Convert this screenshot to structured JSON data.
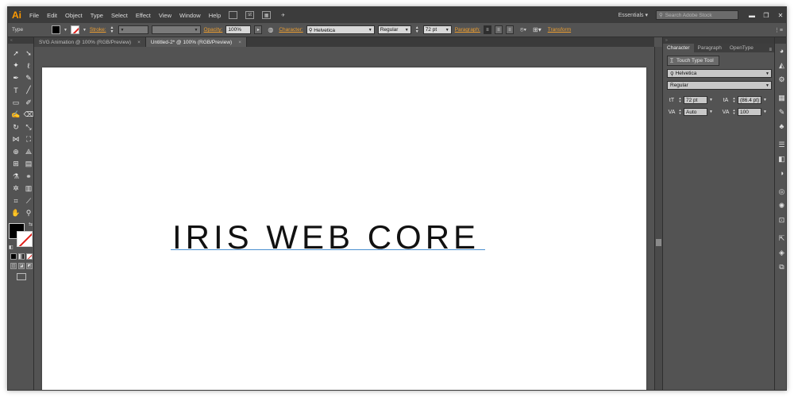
{
  "app": {
    "logo": "Ai",
    "workspace": "Essentials ▾",
    "stock_search_placeholder": "Search Adobe Stock"
  },
  "menu": [
    "File",
    "Edit",
    "Object",
    "Type",
    "Select",
    "Effect",
    "View",
    "Window",
    "Help"
  ],
  "menu_icons": [
    "st",
    "bridge-icon",
    "arrange-icon",
    "gpu-icon"
  ],
  "control_bar": {
    "tool_label": "Type",
    "stroke_label": "Stroke:",
    "opacity_label": "Opacity:",
    "opacity_value": "100%",
    "character_label": "Character:",
    "font_family": "Helvetica",
    "font_style": "Regular",
    "font_size": "72 pt",
    "paragraph_label": "Paragraph:",
    "transform_label": "Transform"
  },
  "tabs": [
    {
      "label": "SVG Animation @ 100% (RGB/Preview)",
      "active": false
    },
    {
      "label": "Untitled-2* @ 100% (RGB/Preview)",
      "active": true
    }
  ],
  "artboard": {
    "text": "IRIS WEB CORE"
  },
  "character_panel": {
    "tabs": [
      "Character",
      "Paragraph",
      "OpenType"
    ],
    "touch_type_label": "Touch Type Tool",
    "font_family": "Helvetica",
    "font_style": "Regular",
    "font_size": "72 pt",
    "leading": "(86.4 pt)",
    "kerning": "Auto",
    "tracking": "100"
  },
  "colors": {
    "accent": "#f0a030",
    "ui_dark": "#535353",
    "menubar": "#3c3c3c",
    "stroke_none": "#e0201a"
  }
}
